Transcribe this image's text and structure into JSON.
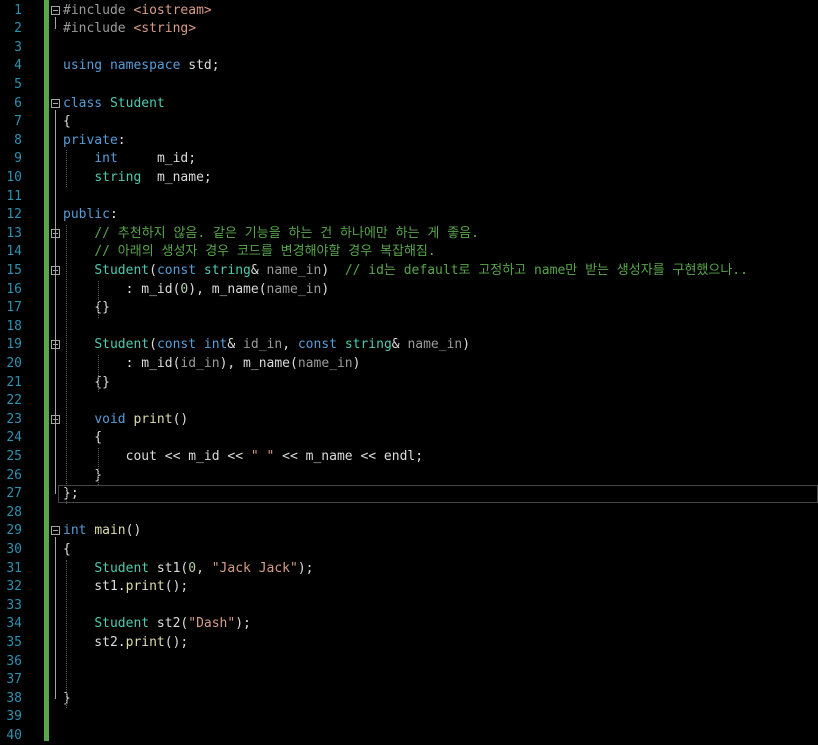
{
  "editor": {
    "language": "C++",
    "colors": {
      "background": "#000000",
      "line_number": "#2b91af",
      "keyword": "#569cd6",
      "type": "#4ec9b0",
      "preprocessor": "#9b9b9b",
      "string": "#d69d85",
      "comment": "#57a64a",
      "function": "#dcdcaa",
      "change_bar": "#57a64a"
    },
    "lines": [
      {
        "n": "1",
        "t": [
          [
            "pp",
            "#include "
          ],
          [
            "st",
            "<iostream>"
          ]
        ],
        "fold": true
      },
      {
        "n": "2",
        "t": [
          [
            "pp",
            "#include "
          ],
          [
            "st",
            "<string>"
          ]
        ]
      },
      {
        "n": "3",
        "t": []
      },
      {
        "n": "4",
        "t": [
          [
            "kw",
            "using"
          ],
          [
            "p",
            " "
          ],
          [
            "kw",
            "namespace"
          ],
          [
            "p",
            " std;"
          ]
        ]
      },
      {
        "n": "5",
        "t": []
      },
      {
        "n": "6",
        "t": [
          [
            "kw",
            "class"
          ],
          [
            "p",
            " "
          ],
          [
            "ty",
            "Student"
          ]
        ],
        "fold": true
      },
      {
        "n": "7",
        "t": [
          [
            "p",
            "{"
          ]
        ]
      },
      {
        "n": "8",
        "t": [
          [
            "kw",
            "private"
          ],
          [
            "p",
            ":"
          ]
        ]
      },
      {
        "n": "9",
        "t": [
          [
            "p",
            "    "
          ],
          [
            "kw",
            "int"
          ],
          [
            "p",
            "     "
          ],
          [
            "fld",
            "m_id"
          ],
          [
            "p",
            ";"
          ]
        ]
      },
      {
        "n": "10",
        "t": [
          [
            "p",
            "    "
          ],
          [
            "ty",
            "string"
          ],
          [
            "p",
            "  "
          ],
          [
            "fld",
            "m_name"
          ],
          [
            "p",
            ";"
          ]
        ]
      },
      {
        "n": "11",
        "t": []
      },
      {
        "n": "12",
        "t": [
          [
            "kw",
            "public"
          ],
          [
            "p",
            ":"
          ]
        ]
      },
      {
        "n": "13",
        "t": [
          [
            "p",
            "    "
          ],
          [
            "cm",
            "// 추천하지 않음. 같은 기능을 하는 건 하나에만 하는 게 좋음."
          ]
        ],
        "fold": true
      },
      {
        "n": "14",
        "t": [
          [
            "p",
            "    "
          ],
          [
            "cm",
            "// 아래의 생성자 경우 코드를 변경해야할 경우 복잡해짐."
          ]
        ]
      },
      {
        "n": "15",
        "t": [
          [
            "p",
            "    "
          ],
          [
            "ty",
            "Student"
          ],
          [
            "p",
            "("
          ],
          [
            "kw",
            "const"
          ],
          [
            "p",
            " "
          ],
          [
            "ty",
            "string"
          ],
          [
            "p",
            "& "
          ],
          [
            "pa",
            "name_in"
          ],
          [
            "p",
            ")  "
          ],
          [
            "cm",
            "// id는 default로 고정하고 name만 받는 생성자를 구현했으나.."
          ]
        ],
        "fold": true
      },
      {
        "n": "16",
        "t": [
          [
            "p",
            "        : "
          ],
          [
            "fld",
            "m_id"
          ],
          [
            "p",
            "("
          ],
          [
            "nm",
            "0"
          ],
          [
            "p",
            "), "
          ],
          [
            "fld",
            "m_name"
          ],
          [
            "p",
            "("
          ],
          [
            "pa",
            "name_in"
          ],
          [
            "p",
            ")"
          ]
        ]
      },
      {
        "n": "17",
        "t": [
          [
            "p",
            "    {}"
          ]
        ]
      },
      {
        "n": "18",
        "t": []
      },
      {
        "n": "19",
        "t": [
          [
            "p",
            "    "
          ],
          [
            "ty",
            "Student"
          ],
          [
            "p",
            "("
          ],
          [
            "kw",
            "const"
          ],
          [
            "p",
            " "
          ],
          [
            "kw",
            "int"
          ],
          [
            "p",
            "& "
          ],
          [
            "pa",
            "id_in"
          ],
          [
            "p",
            ", "
          ],
          [
            "kw",
            "const"
          ],
          [
            "p",
            " "
          ],
          [
            "ty",
            "string"
          ],
          [
            "p",
            "& "
          ],
          [
            "pa",
            "name_in"
          ],
          [
            "p",
            ")"
          ]
        ],
        "fold": true
      },
      {
        "n": "20",
        "t": [
          [
            "p",
            "        : "
          ],
          [
            "fld",
            "m_id"
          ],
          [
            "p",
            "("
          ],
          [
            "pa",
            "id_in"
          ],
          [
            "p",
            "), "
          ],
          [
            "fld",
            "m_name"
          ],
          [
            "p",
            "("
          ],
          [
            "pa",
            "name_in"
          ],
          [
            "p",
            ")"
          ]
        ]
      },
      {
        "n": "21",
        "t": [
          [
            "p",
            "    {}"
          ]
        ]
      },
      {
        "n": "22",
        "t": []
      },
      {
        "n": "23",
        "t": [
          [
            "p",
            "    "
          ],
          [
            "kw",
            "void"
          ],
          [
            "p",
            " "
          ],
          [
            "fn",
            "print"
          ],
          [
            "p",
            "()"
          ]
        ],
        "fold": true
      },
      {
        "n": "24",
        "t": [
          [
            "p",
            "    {"
          ]
        ]
      },
      {
        "n": "25",
        "t": [
          [
            "p",
            "        cout << "
          ],
          [
            "fld",
            "m_id"
          ],
          [
            "p",
            " << "
          ],
          [
            "st",
            "\" \""
          ],
          [
            "p",
            " << "
          ],
          [
            "fld",
            "m_name"
          ],
          [
            "p",
            " << endl;"
          ]
        ]
      },
      {
        "n": "26",
        "t": [
          [
            "p",
            "    }"
          ]
        ]
      },
      {
        "n": "27",
        "t": [
          [
            "p",
            "};"
          ]
        ],
        "current": true
      },
      {
        "n": "28",
        "t": []
      },
      {
        "n": "29",
        "t": [
          [
            "kw",
            "int"
          ],
          [
            "p",
            " "
          ],
          [
            "fn",
            "main"
          ],
          [
            "p",
            "()"
          ]
        ],
        "fold": true
      },
      {
        "n": "30",
        "t": [
          [
            "p",
            "{"
          ]
        ]
      },
      {
        "n": "31",
        "t": [
          [
            "p",
            "    "
          ],
          [
            "ty",
            "Student"
          ],
          [
            "p",
            " st1("
          ],
          [
            "nm",
            "0"
          ],
          [
            "p",
            ", "
          ],
          [
            "st",
            "\"Jack Jack\""
          ],
          [
            "p",
            ");"
          ]
        ]
      },
      {
        "n": "32",
        "t": [
          [
            "p",
            "    st1."
          ],
          [
            "fn",
            "print"
          ],
          [
            "p",
            "();"
          ]
        ]
      },
      {
        "n": "33",
        "t": []
      },
      {
        "n": "34",
        "t": [
          [
            "p",
            "    "
          ],
          [
            "ty",
            "Student"
          ],
          [
            "p",
            " st2("
          ],
          [
            "st",
            "\"Dash\""
          ],
          [
            "p",
            ");"
          ]
        ]
      },
      {
        "n": "35",
        "t": [
          [
            "p",
            "    st2."
          ],
          [
            "fn",
            "print"
          ],
          [
            "p",
            "();"
          ]
        ]
      },
      {
        "n": "36",
        "t": []
      },
      {
        "n": "37",
        "t": []
      },
      {
        "n": "38",
        "t": [
          [
            "p",
            "}"
          ]
        ]
      },
      {
        "n": "39",
        "t": []
      },
      {
        "n": "40",
        "t": []
      }
    ]
  }
}
